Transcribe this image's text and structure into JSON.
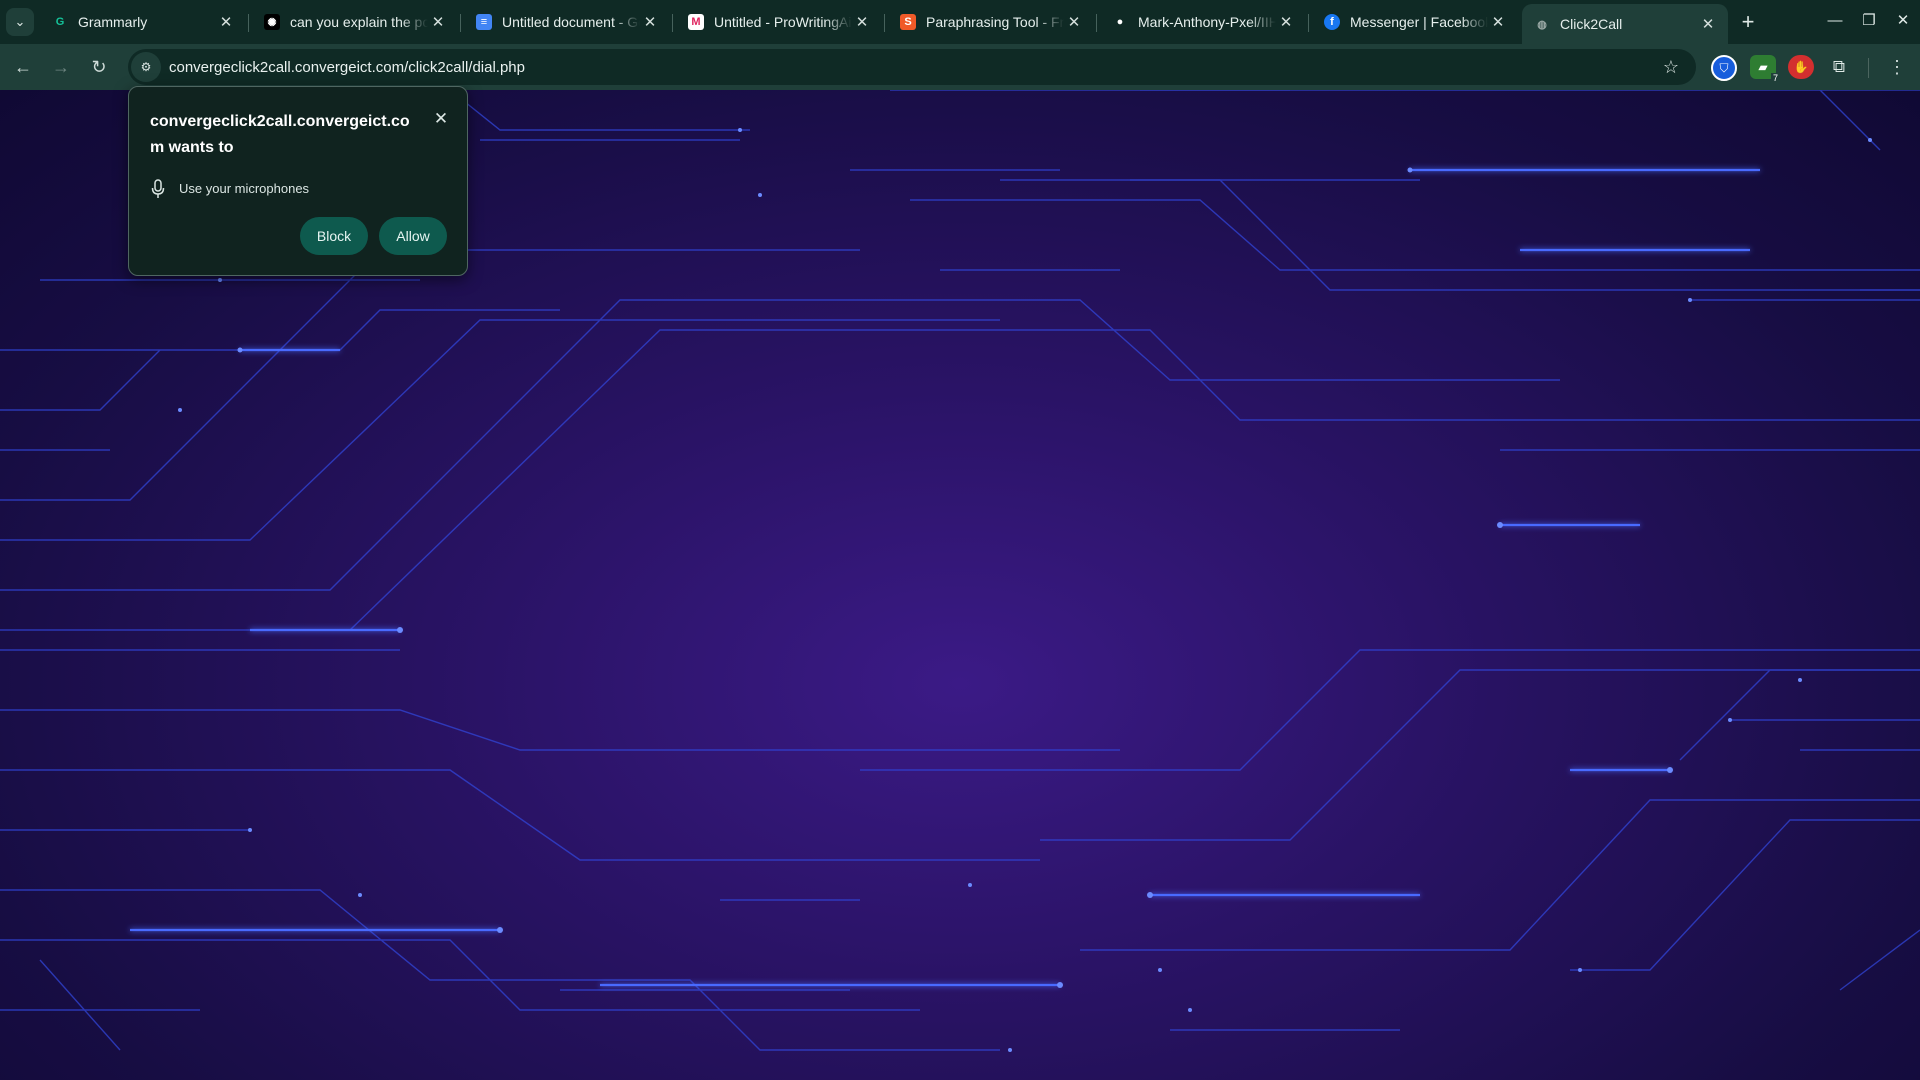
{
  "browser": {
    "tabs": [
      {
        "title": "Grammarly",
        "favicon": "grammarly-icon",
        "favicon_glyph": "G",
        "favicon_color": "#15c39a",
        "active": false
      },
      {
        "title": "can you explain the porp",
        "favicon": "openai-icon",
        "favicon_glyph": "✺",
        "favicon_color": "#000000",
        "active": false
      },
      {
        "title": "Untitled document - Goo",
        "favicon": "google-docs-icon",
        "favicon_glyph": "≡",
        "favicon_color": "#4285f4",
        "active": false
      },
      {
        "title": "Untitled - ProWritingAid",
        "favicon": "prowritingaid-icon",
        "favicon_glyph": "M",
        "favicon_color": "#ffffff",
        "active": false
      },
      {
        "title": "Paraphrasing Tool - Free",
        "favicon": "quillbot-icon",
        "favicon_glyph": "S",
        "favicon_color": "#f05a28",
        "active": false
      },
      {
        "title": "Mark-Anthony-Pxel/IIHC",
        "favicon": "github-icon",
        "favicon_glyph": "●",
        "favicon_color": "#ffffff",
        "active": false
      },
      {
        "title": "Messenger | Facebook",
        "favicon": "facebook-icon",
        "favicon_glyph": "f",
        "favicon_color": "#1877f2",
        "active": false
      },
      {
        "title": "Click2Call",
        "favicon": "globe-icon",
        "favicon_glyph": "◍",
        "favicon_color": "#9aa8a5",
        "active": true
      }
    ],
    "address_bar": {
      "url": "convergeclick2call.convergeict.com/click2call/dial.php"
    },
    "extensions": [
      {
        "name": "bitwarden-icon",
        "glyph": "⛉",
        "color": "#175ddc"
      },
      {
        "name": "tab-counter-icon",
        "glyph": "▰",
        "color": "#2e7d32",
        "badge": "7"
      },
      {
        "name": "adblock-icon",
        "glyph": "✋",
        "color": "#d32f2f"
      },
      {
        "name": "extensions-puzzle-icon",
        "glyph": "⧉",
        "color": "transparent"
      }
    ]
  },
  "permission_prompt": {
    "title": "convergeclick2call.convergeict.com wants to",
    "permission_label": "Use your microphones",
    "block_label": "Block",
    "allow_label": "Allow"
  },
  "colors": {
    "accent_button": "#0e5a4e",
    "circuit_line": "#3a4bff",
    "background": "#2a1366"
  }
}
